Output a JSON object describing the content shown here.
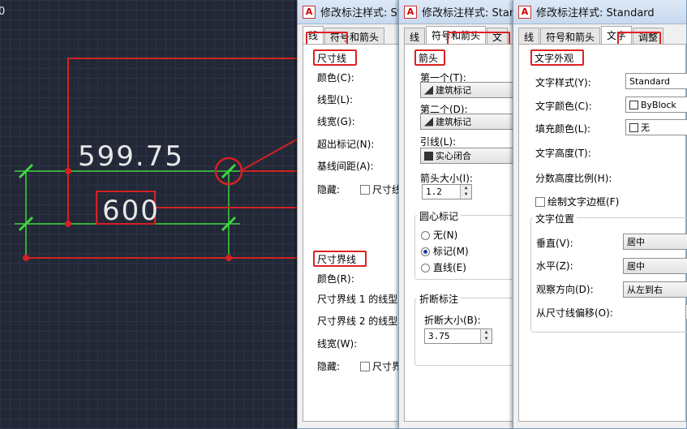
{
  "cad": {
    "dim_top_text": "599.75",
    "dim_bottom_text": "600",
    "corner_text": "0"
  },
  "dialog1": {
    "title": "修改标注样式: Standard",
    "tabs": [
      "线",
      "符号和箭头"
    ],
    "section_dim_line": "尺寸线",
    "color_label": "颜色(C):",
    "linetype_label": "线型(L):",
    "lineweight_label": "线宽(G):",
    "extend_ticks_label": "超出标记(N):",
    "baseline_spacing_label": "基线间距(A):",
    "suppress_label": "隐藏:",
    "suppress_chk": "尺寸线",
    "section_ext_line": "尺寸界线",
    "ext_color_label": "颜色(R):",
    "ext_line1_label": "尺寸界线 1 的线型",
    "ext_line2_label": "尺寸界线 2 的线型",
    "ext_lineweight_label": "线宽(W):",
    "ext_suppress_label": "隐藏:",
    "ext_suppress_chk": "尺寸界"
  },
  "dialog2": {
    "title": "修改标注样式: Standard",
    "tabs": [
      "线",
      "符号和箭头",
      "文"
    ],
    "section_arrowheads": "箭头",
    "first_label": "第一个(T):",
    "first_value": "建筑标记",
    "second_label": "第二个(D):",
    "second_value": "建筑标记",
    "leader_label": "引线(L):",
    "leader_value": "实心闭合",
    "arrow_size_label": "箭头大小(I):",
    "arrow_size_value": "1.2",
    "center_marks_title": "圆心标记",
    "radio_none": "无(N)",
    "radio_mark": "标记(M)",
    "radio_line": "直线(E)",
    "break_title": "折断标注",
    "break_size_label": "折断大小(B):",
    "break_size_value": "3.75"
  },
  "dialog3": {
    "title": "修改标注样式: Standard",
    "tabs": [
      "线",
      "符号和箭头",
      "文字",
      "调整"
    ],
    "section_text_appearance": "文字外观",
    "text_style_label": "文字样式(Y):",
    "text_style_value": "Standard",
    "text_color_label": "文字颜色(C):",
    "text_color_value": "ByBlock",
    "fill_color_label": "填充颜色(L):",
    "fill_color_value": "无",
    "text_height_label": "文字高度(T):",
    "fraction_scale_label": "分数高度比例(H):",
    "frame_chk": "绘制文字边框(F)",
    "placement_title": "文字位置",
    "vertical_label": "垂直(V):",
    "vertical_value": "居中",
    "horizontal_label": "水平(Z):",
    "horizontal_value": "居中",
    "view_dir_label": "观察方向(D):",
    "view_dir_value": "从左到右",
    "offset_label": "从尺寸线偏移(O):"
  },
  "colors": {
    "highlight": "#d22222",
    "dim_green": "#3ed63e",
    "cad_bg": "#232837"
  }
}
